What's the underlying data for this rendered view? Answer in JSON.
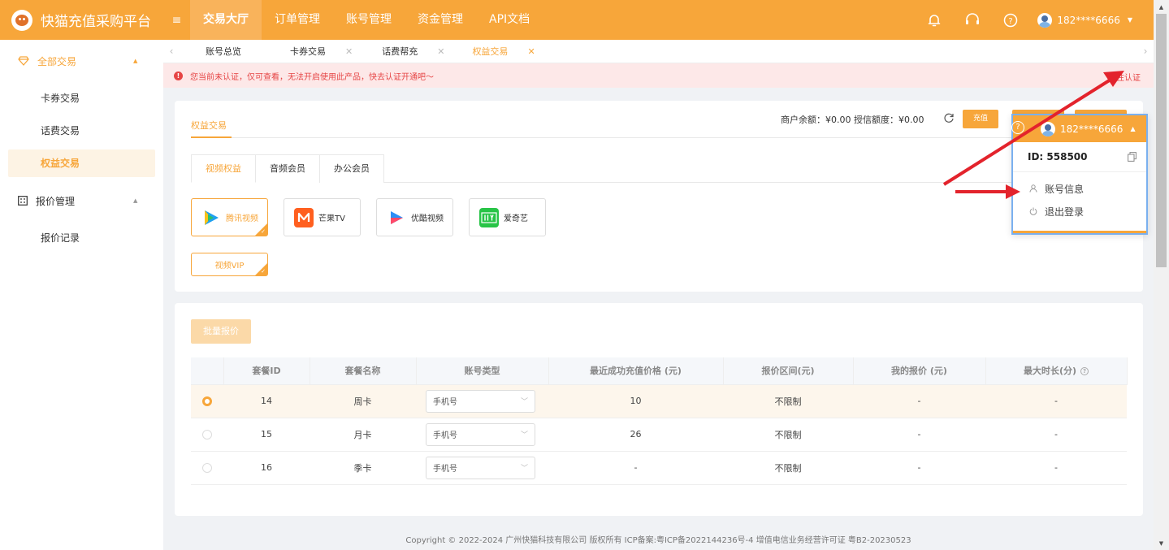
{
  "header": {
    "brand": "快猫充值采购平台",
    "nav": [
      "交易大厅",
      "订单管理",
      "账号管理",
      "资金管理",
      "API文档"
    ],
    "user": "182****6666"
  },
  "sidebar": {
    "group1": "全部交易",
    "items1": [
      "卡券交易",
      "话费交易",
      "权益交易"
    ],
    "group2": "报价管理",
    "items2": [
      "报价记录"
    ]
  },
  "tabs": [
    "账号总览",
    "卡券交易",
    "话费帮充",
    "权益交易"
  ],
  "warning": {
    "text": "您当前未认证，仅可查看，无法开启使用此产品，快去认证开通吧～",
    "link": "前往认证"
  },
  "card1": {
    "title": "权益交易",
    "balance": "商户余额：¥0.00  授信额度：¥0.00",
    "recharge": "充值",
    "subtabs": [
      "视频权益",
      "音频会员",
      "办公会员"
    ],
    "products": [
      "腾讯视频",
      "芒果TV",
      "优酷视频",
      "爱奇艺"
    ],
    "vip": "视频VIP"
  },
  "table": {
    "batch_btn": "批量报价",
    "headers": [
      "套餐ID",
      "套餐名称",
      "账号类型",
      "最近成功充值价格 (元)",
      "报价区间(元)",
      "我的报价 (元)",
      "最大时长(分)"
    ],
    "rows": [
      {
        "id": "14",
        "name": "周卡",
        "type": "手机号",
        "price": "10",
        "range": "不限制",
        "mine": "-",
        "max": "-"
      },
      {
        "id": "15",
        "name": "月卡",
        "type": "手机号",
        "price": "26",
        "range": "不限制",
        "mine": "-",
        "max": "-"
      },
      {
        "id": "16",
        "name": "季卡",
        "type": "手机号",
        "price": "-",
        "range": "不限制",
        "mine": "-",
        "max": "-"
      }
    ]
  },
  "footer": "Copyright © 2022-2024 广州快猫科技有限公司 版权所有 ICP备案:粤ICP备2022144236号-4 增值电信业务经营许可证 粤B2-20230523",
  "dropdown": {
    "user": "182****6666",
    "id": "ID:  558500",
    "items": [
      "账号信息",
      "退出登录"
    ]
  },
  "colors": {
    "accent": "#f7a63a",
    "warn": "#e64545",
    "annotation_arrow": "#e3232c"
  }
}
